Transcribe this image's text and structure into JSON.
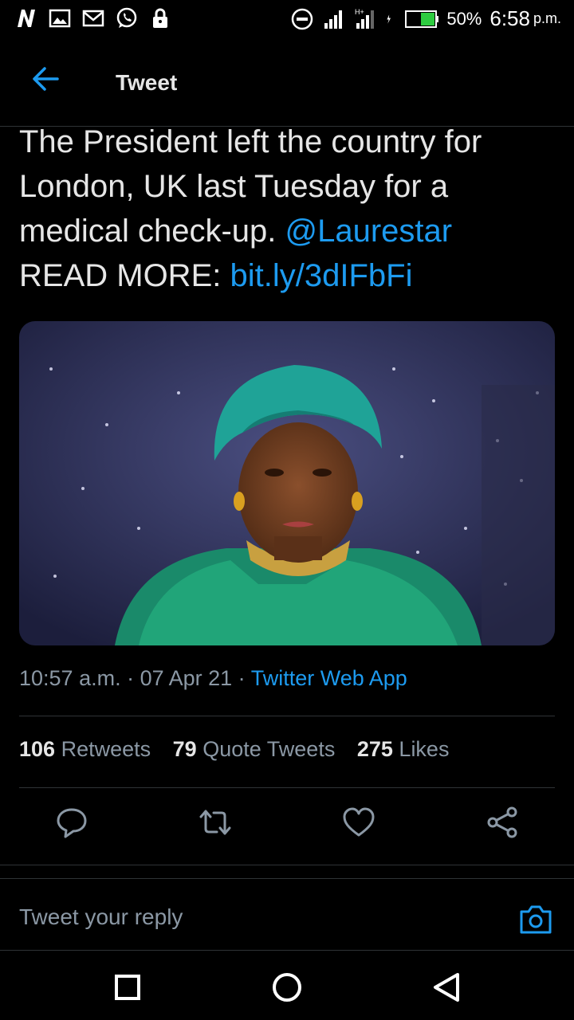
{
  "status_bar": {
    "battery_percent": "50%",
    "time": "6:58",
    "ampm": "p.m.",
    "network_label": "H+",
    "icons": [
      "n-icon",
      "gallery-icon",
      "gmail-icon",
      "whatsapp-icon",
      "lock-icon",
      "dnd-icon",
      "signal-icon",
      "signal-hplus-icon",
      "charging-icon",
      "battery-icon"
    ]
  },
  "header": {
    "title": "Tweet",
    "back_icon": "back-arrow-icon"
  },
  "tweet": {
    "text_part1": "The President left the country for London, UK last Tuesday for a medical check-up. ",
    "mention": "@Laurestar",
    "text_part2": "READ MORE: ",
    "link": "bit.ly/3dIFbFi",
    "time": "10:57 a.m.",
    "sep": " · ",
    "date": "07 Apr 21",
    "source": "Twitter Web App"
  },
  "stats": {
    "retweets_count": "106",
    "retweets_label": "Retweets",
    "quotes_count": "79",
    "quotes_label": "Quote Tweets",
    "likes_count": "275",
    "likes_label": "Likes"
  },
  "reply": {
    "placeholder": "Tweet your reply"
  },
  "colors": {
    "accent": "#1d9bf0",
    "background": "#000000",
    "muted": "#8b98a5",
    "divider": "#2f3336",
    "battery_green": "#2ecc40"
  }
}
